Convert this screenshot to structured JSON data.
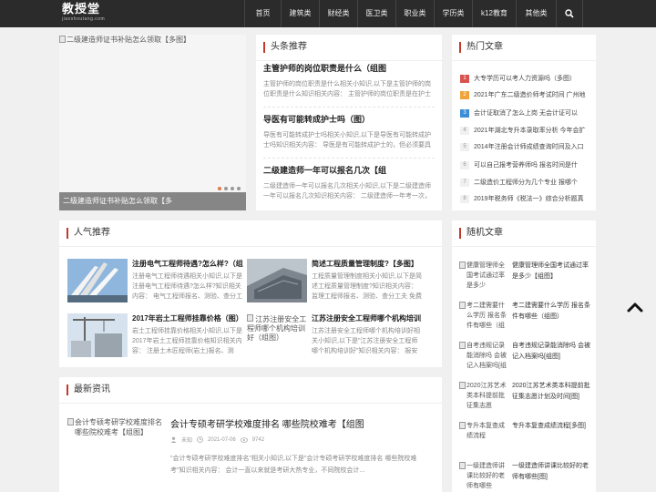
{
  "logo": {
    "main": "教授堂",
    "sub": "jiaoshoutang.com"
  },
  "nav": {
    "items": [
      "首页",
      "建筑类",
      "财经类",
      "医卫类",
      "职业类",
      "学历类",
      "k12教育",
      "其他类"
    ],
    "search_icon": "search-icon"
  },
  "slider": {
    "image_alt": "二级建造师证书补贴怎么领取【多图】",
    "caption": "二级建造师证书补贴怎么领取【多",
    "dots": 4,
    "active_dot": 0
  },
  "headline": {
    "title": "头条推荐",
    "items": [
      {
        "title": "主管护师的岗位职责是什么（组图",
        "desc": "主管护师的岗位职责是什么相关小知识,以下是主管护师的岗位职责是什么知识相关内容： 主管护师的岗位职责是在护士"
      },
      {
        "title": "导医有可能转成护士吗（图）",
        "desc": "导医有可能转成护士吗相关小知识,以下是导医有可能转成护士吗知识相关内容： 导医是有可能转成护士的，但必须要具"
      },
      {
        "title": "二级建造师一年可以报名几次【组",
        "desc": "二级建造师一年可以报名几次相关小知识,以下是二级建造师一年可以报名几次知识相关内容： 二级建造师一年考一次，"
      }
    ]
  },
  "hot": {
    "title": "热门文章",
    "items": [
      {
        "rank": "1",
        "text": "大专学历可以考人力资源吗（多图）"
      },
      {
        "rank": "2",
        "text": "2021年广东二级造价师考试时间 广州地"
      },
      {
        "rank": "3",
        "text": "会计证取消了怎么上岗 无会计证可以"
      },
      {
        "rank": "4",
        "text": "2021年湖北专升本录取率分析 今年会扩"
      },
      {
        "rank": "5",
        "text": "2014年注册会计师成绩查询时间及入口"
      },
      {
        "rank": "6",
        "text": "可以自己报考营养师吗 报名时间是什"
      },
      {
        "rank": "7",
        "text": "二级造价工程师分为几个专业 报哪个"
      },
      {
        "rank": "8",
        "text": "2019年税务师《税法一》综合分析题真"
      }
    ]
  },
  "popular": {
    "title": "人气推荐",
    "items": [
      {
        "title": "注册电气工程师待遇?怎么样?（组",
        "desc": "注册电气工程师待遇相关小知识,以下是注册电气工程师待遇?怎么样?知识相关内容： 电气工程师报名、测验、查分工夫",
        "thumb_alt": ""
      },
      {
        "title": "简述工程质量管理制度?【多图】",
        "desc": "工程质量管理制度相关小知识,以下是简述工程质量管理制度?知识相关内容： 监理工程师报名、测验、查分工夫 免费短",
        "thumb_alt": ""
      },
      {
        "title": "2017年岩土工程师挂靠价格（图）",
        "desc": "岩土工程师挂靠价格相关小知识,以下是2017年岩土工程师挂靠价格知识相关内容： 注册土木匠程师(岩土)报名、测验、",
        "thumb_alt": ""
      },
      {
        "title": "江苏注册安全工程师哪个机构培训",
        "desc": "江苏注册安全工程师哪个机构培训好相关小知识,以下是\"江苏注册安全工程师哪个机构培训好\"知识相关内容： 报安全工",
        "thumb_alt": "江苏注册安全工程师哪个机构培训好（组图）"
      }
    ]
  },
  "latest": {
    "title": "最新资讯",
    "items": [
      {
        "thumb_alt": "会计专硕考研学校难度排名 哪些院校难考【组图】",
        "title": "会计专硕考研学校难度排名 哪些院校难考【组图",
        "author": "未知",
        "date": "2021-07-06",
        "views": "9742",
        "desc": "\"会计专硕考研学校难度排名\"相关小知识,以下是\"会计专硕考研学校难度排名 哪些院校难考\"知识相关内容： 会计一直以来就是考研大热专业，不同院校会计..."
      }
    ]
  },
  "random": {
    "title": "随机文章",
    "items": [
      {
        "thumb_alt": "健康管理师全国考试通过率是多少",
        "text": "健康管理师全国考试通过率是多少【组图】"
      },
      {
        "thumb_alt": "考二建需要什么学历 报名条件有哪些（组",
        "text": "考二建需要什么学历 报名条件有哪些（组图）"
      },
      {
        "thumb_alt": "自考违规记录能消除吗 会被记入档案吗[组",
        "text": "自考违规记录能消除吗 会被记入档案吗[组图]"
      },
      {
        "thumb_alt": "2020江苏艺术类本科提前批征集志愿",
        "text": "2020江苏艺术类本科提前批征集志愿计划及时间[图]"
      },
      {
        "thumb_alt": "专升本复查成绩流程",
        "text": "专升本复查成绩流程[多图]"
      },
      {
        "thumb_alt": "一级建造师讲课比较好的老师有哪些",
        "text": "一级建造师讲课比较好的老师有哪些[图]"
      }
    ]
  },
  "colors": {
    "accent": "#c0392b",
    "topbar": "#2b2b2b"
  }
}
